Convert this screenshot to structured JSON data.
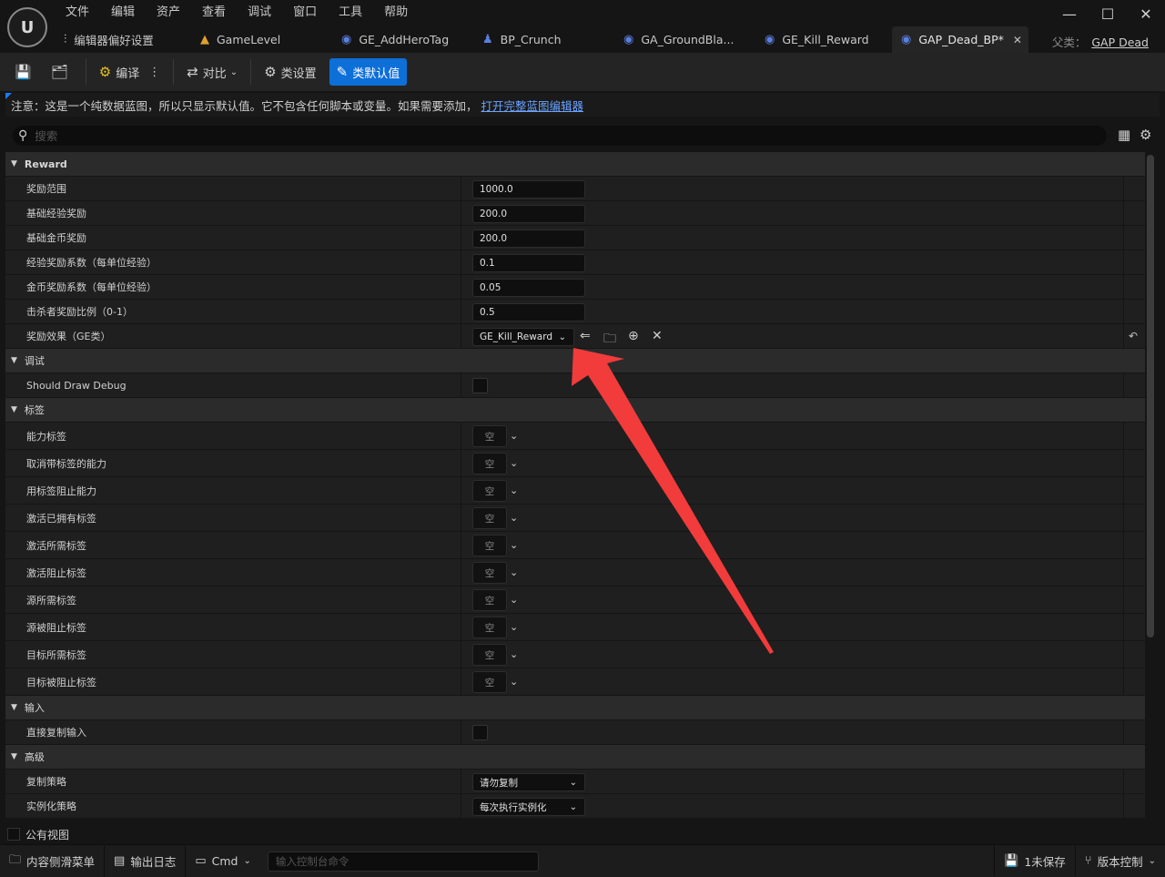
{
  "app": {
    "logo_text": "U"
  },
  "menu": [
    "文件",
    "编辑",
    "资产",
    "查看",
    "调试",
    "窗口",
    "工具",
    "帮助"
  ],
  "window_controls": {
    "minimize": "—",
    "maximize": "☐",
    "close": "✕"
  },
  "tabs": [
    {
      "label": "编辑器偏好设置",
      "icon": "sliders-icon"
    },
    {
      "label": "GameLevel",
      "icon": "level-icon"
    },
    {
      "label": "GE_AddHeroTag",
      "icon": "blueprint-icon"
    },
    {
      "label": "BP_Crunch",
      "icon": "character-icon"
    },
    {
      "label": "GA_GroundBla...",
      "icon": "blueprint-icon"
    },
    {
      "label": "GE_Kill_Reward",
      "icon": "blueprint-icon"
    },
    {
      "label": "GAP_Dead_BP*",
      "icon": "blueprint-icon",
      "active": true
    }
  ],
  "parent": {
    "label": "父类：",
    "value": "GAP Dead"
  },
  "toolbar": {
    "compile": "编译",
    "diff": "对比",
    "class_settings": "类设置",
    "class_defaults": "类默认值"
  },
  "notice": {
    "text": "注意：这是一个纯数据蓝图，所以只显示默认值。它不包含任何脚本或变量。如果需要添加，",
    "link": "打开完整蓝图编辑器"
  },
  "search": {
    "placeholder": "搜索"
  },
  "categories": {
    "reward": "Reward",
    "debug": "调试",
    "tags": "标签",
    "input": "输入",
    "advanced": "高级"
  },
  "reward_rows": [
    {
      "label": "奖励范围",
      "value": "1000.0"
    },
    {
      "label": "基础经验奖励",
      "value": "200.0"
    },
    {
      "label": "基础金币奖励",
      "value": "200.0"
    },
    {
      "label": "经验奖励系数（每单位经验）",
      "value": "0.1"
    },
    {
      "label": "金币奖励系数（每单位经验）",
      "value": "0.05"
    },
    {
      "label": "击杀者奖励比例（0-1）",
      "value": "0.5"
    }
  ],
  "reward_effect": {
    "label": "奖励效果（GE类）",
    "value": "GE_Kill_Reward"
  },
  "debug_rows": [
    {
      "label": "Should Draw Debug",
      "checked": false
    }
  ],
  "tag_rows": [
    {
      "label": "能力标签",
      "value": "空"
    },
    {
      "label": "取消带标签的能力",
      "value": "空"
    },
    {
      "label": "用标签阻止能力",
      "value": "空"
    },
    {
      "label": "激活已拥有标签",
      "value": "空"
    },
    {
      "label": "激活所需标签",
      "value": "空"
    },
    {
      "label": "激活阻止标签",
      "value": "空"
    },
    {
      "label": "源所需标签",
      "value": "空"
    },
    {
      "label": "源被阻止标签",
      "value": "空"
    },
    {
      "label": "目标所需标签",
      "value": "空"
    },
    {
      "label": "目标被阻止标签",
      "value": "空"
    }
  ],
  "input_rows": [
    {
      "label": "直接复制输入",
      "checked": false
    }
  ],
  "advanced_rows": [
    {
      "label": "复制策略",
      "value": "请勿复制"
    },
    {
      "label": "实例化策略",
      "value": "每次执行实例化"
    }
  ],
  "public_view": "公有视图",
  "statusbar": {
    "content_drawer": "内容侧滑菜单",
    "output_log": "输出日志",
    "cmd": "Cmd",
    "cmd_placeholder": "输入控制台命令",
    "unsaved": "1未保存",
    "source_control": "版本控制"
  },
  "colors": {
    "accent": "#0d6fd8",
    "annotation_arrow": "#f23b3b",
    "link": "#6aa3ff"
  }
}
